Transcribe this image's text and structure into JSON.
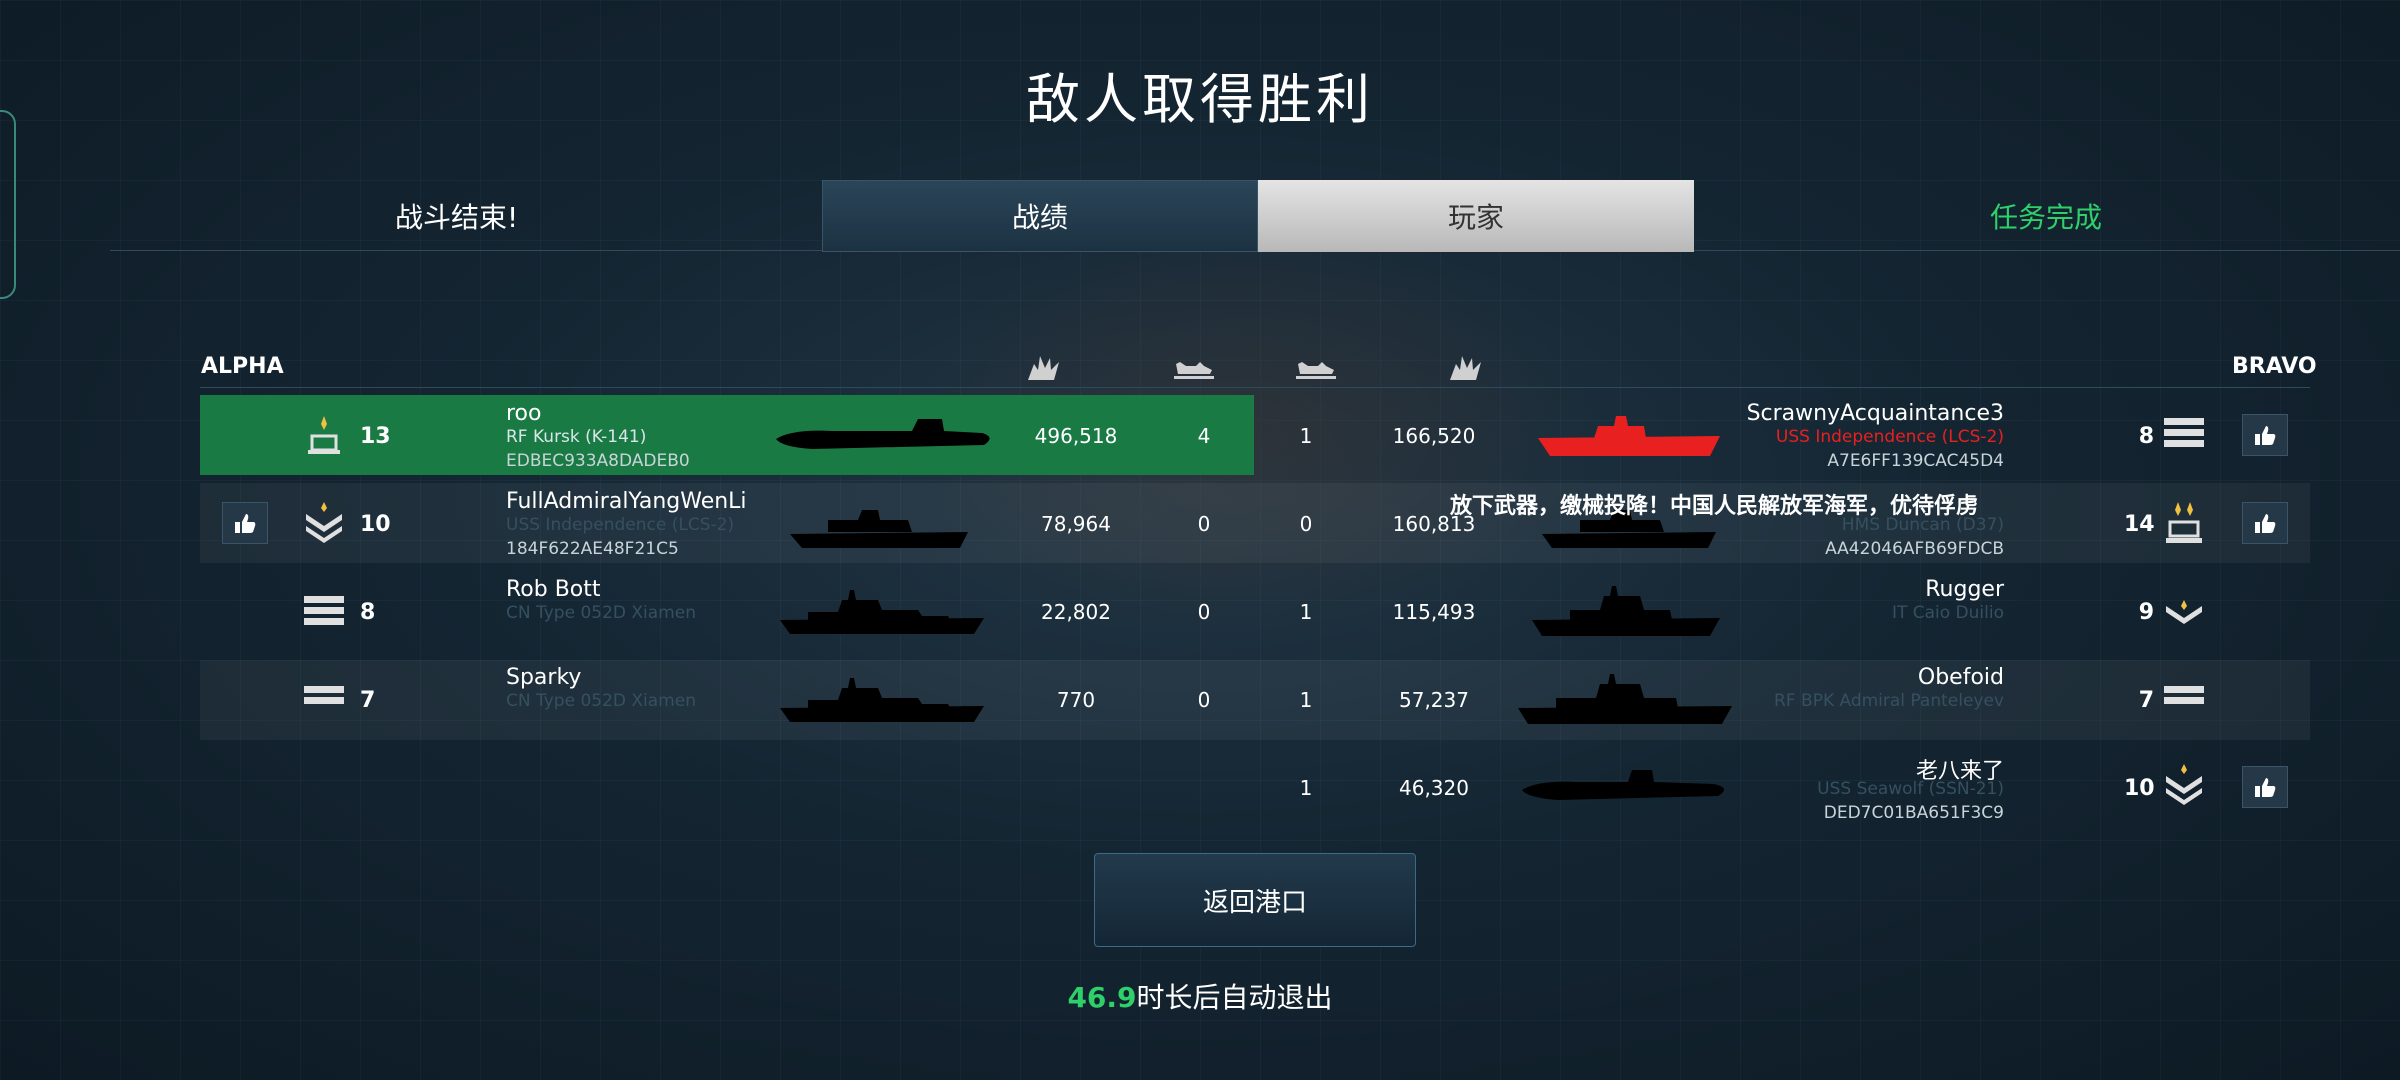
{
  "title": "敌人取得胜利",
  "tabs": {
    "battle_over": "战斗结束!",
    "stats": "战绩",
    "players": "玩家",
    "mission": "任务完成"
  },
  "teams": {
    "left": "ALPHA",
    "right": "BRAVO"
  },
  "header_icons": [
    "explosion-icon",
    "ship-sunk-icon",
    "ship-sunk-icon",
    "explosion-icon"
  ],
  "alpha": [
    {
      "level": "13",
      "name": "roo",
      "ship": "RF Kursk (K-141)",
      "code": "EDBEC933A8DADEB0",
      "damage": "496,518",
      "kills": "4",
      "highlight": true
    },
    {
      "level": "10",
      "name": "FullAdmiralYangWenLi",
      "ship": "USS Independence (LCS-2)",
      "code": "184F622AE48F21C5",
      "damage": "78,964",
      "kills": "0"
    },
    {
      "level": "8",
      "name": "Rob Bott",
      "ship": "CN Type 052D Xiamen",
      "code": "",
      "damage": "22,802",
      "kills": "0"
    },
    {
      "level": "7",
      "name": "Sparky",
      "ship": "CN Type 052D Xiamen",
      "code": "",
      "damage": "770",
      "kills": "0"
    }
  ],
  "bravo": [
    {
      "level": "8",
      "name": "ScrawnyAcquaintance3",
      "ship": "USS Independence (LCS-2)",
      "code": "A7E6FF139CAC45D4",
      "damage": "166,520",
      "kills": "1"
    },
    {
      "level": "14",
      "name": "放下武器，缴械投降！中国人民解放军海军，优待俘虏",
      "ship": "HMS Duncan (D37)",
      "code": "AA42046AFB69FDCB",
      "damage": "160,813",
      "kills": "0"
    },
    {
      "level": "9",
      "name": "Rugger",
      "ship": "IT Caio Duilio",
      "code": "",
      "damage": "115,493",
      "kills": "1"
    },
    {
      "level": "7",
      "name": "Obefoid",
      "ship": "RF BPK Admiral Panteleyev",
      "code": "",
      "damage": "57,237",
      "kills": "1"
    },
    {
      "level": "10",
      "name": "老八来了",
      "ship": "USS Seawolf (SSN-21)",
      "code": "DED7C01BA651F3C9",
      "damage": "46,320",
      "kills": "1"
    }
  ],
  "return_button": "返回港口",
  "exit": {
    "seconds": "46.9",
    "text": "时长后自动退出"
  },
  "colors": {
    "highlight": "#1a7a44",
    "accent_green": "#2fd06a",
    "enemy_red": "#e82020"
  }
}
